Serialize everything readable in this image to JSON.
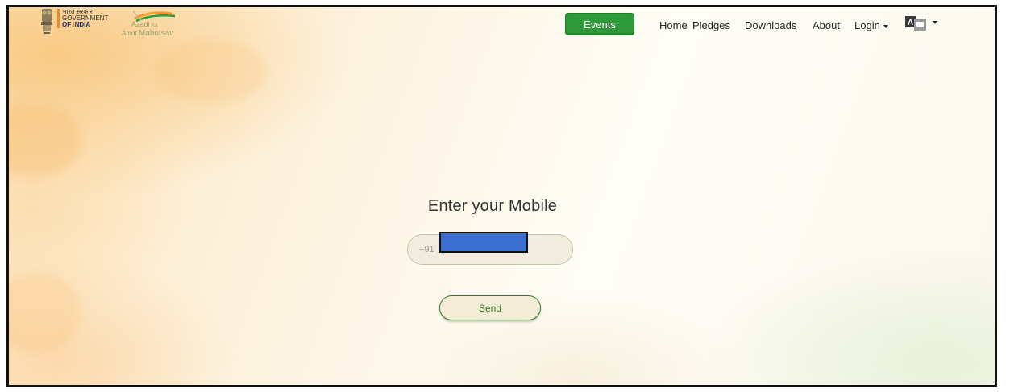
{
  "header": {
    "goi_hindi": "भारत सरकार",
    "goi_line1": "GOVERNMENT",
    "goi_line2_of": "OF ",
    "goi_line2_i": "I",
    "goi_line2_ndia": "NDIA",
    "aka_azadi": "Azadi",
    "aka_ka": "Ka",
    "aka_amrit": "Amrit",
    "aka_mahotsav": "Mahotsav"
  },
  "nav": {
    "events": "Events",
    "home": "Home",
    "pledges": "Pledges",
    "downloads": "Downloads",
    "about": "About",
    "login": "Login"
  },
  "form": {
    "title": "Enter your Mobile",
    "phone_prefix": "+91",
    "send": "Send"
  },
  "colors": {
    "events_bg": "#2f9a3a",
    "send_border": "#2f7a2f",
    "redaction": "#3b6fd0"
  },
  "icons": {
    "emblem": "national-emblem-icon",
    "logo": "azadi-ka-amrit-mahotsav-logo",
    "language": "translate-icon",
    "dropdown": "caret-down-icon"
  }
}
